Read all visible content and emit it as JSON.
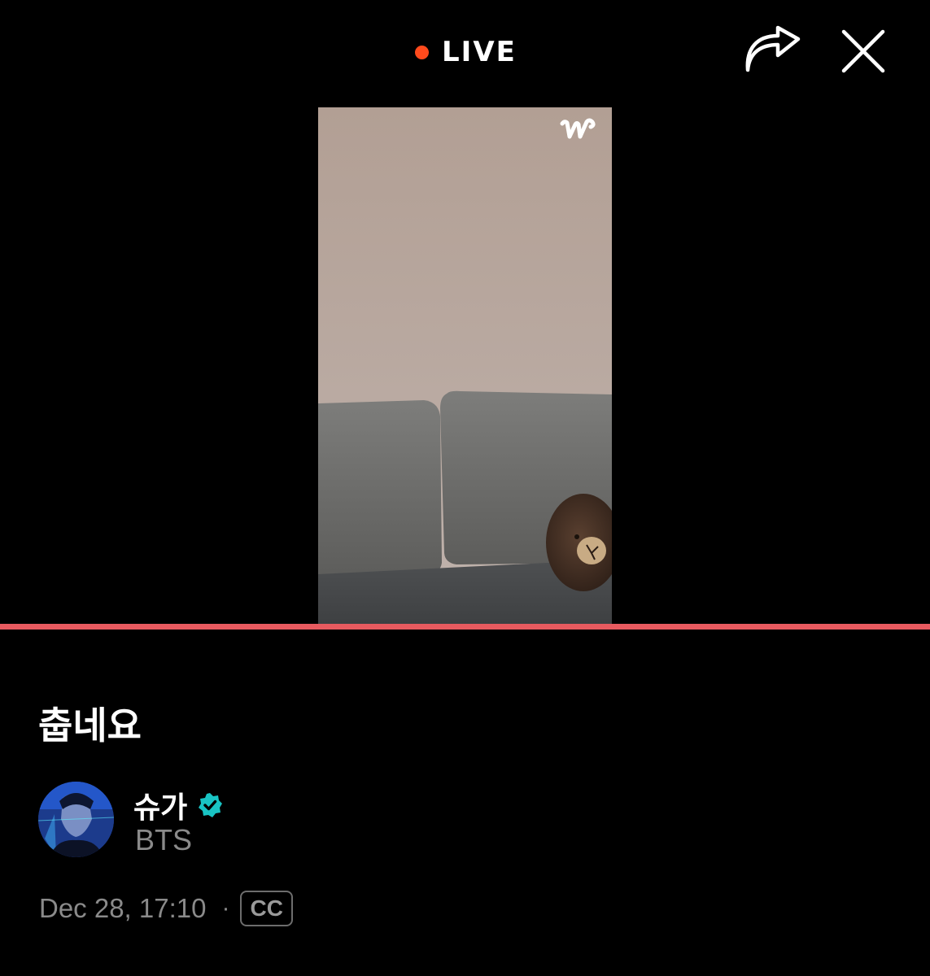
{
  "header": {
    "live_label": "LIVE",
    "live_dot_color": "#ff4a1c",
    "share_icon": "share-icon",
    "close_icon": "close-icon"
  },
  "video": {
    "watermark_icon": "weverse-w-logo",
    "progress_color": "#e85a5f"
  },
  "post": {
    "title": "춥네요",
    "artist_name": "슈가",
    "artist_group": "BTS",
    "verified_icon": "verified-badge-icon",
    "verified_color": "#19c4c4",
    "date": "Dec 28, 17:10",
    "separator": "·",
    "cc_label": "CC"
  }
}
